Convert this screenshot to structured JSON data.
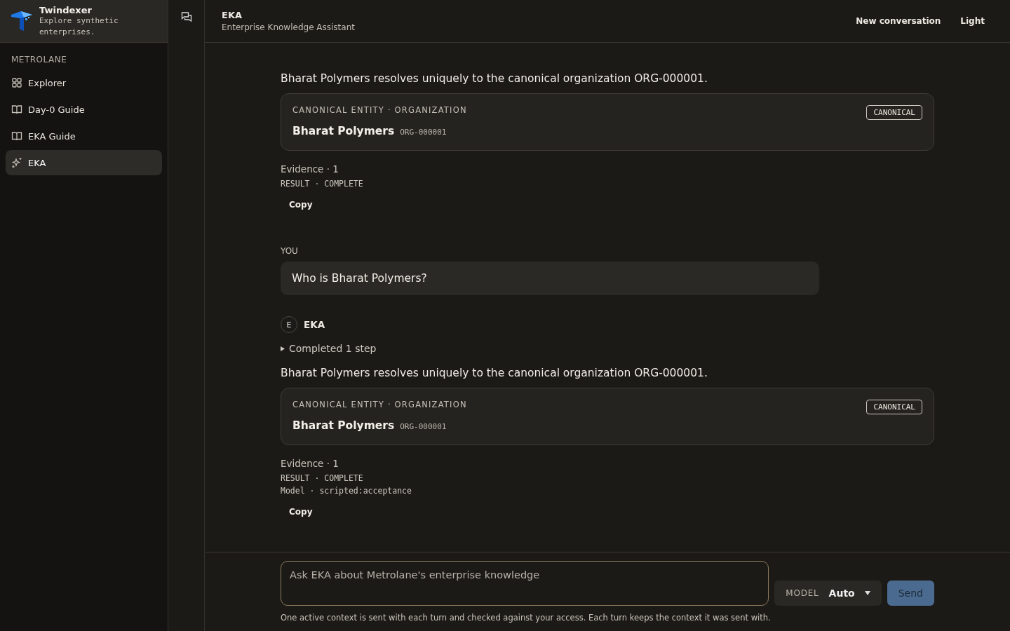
{
  "brand": {
    "name": "Twindexer",
    "tagline": "Explore synthetic enterprises."
  },
  "sidebar": {
    "section": "METROLANE",
    "items": [
      {
        "label": "Explorer",
        "kind": "grid",
        "selected": false
      },
      {
        "label": "Day-0 Guide",
        "kind": "book",
        "selected": false
      },
      {
        "label": "EKA Guide",
        "kind": "book",
        "selected": false
      },
      {
        "label": "EKA",
        "kind": "sparkle",
        "selected": true
      }
    ]
  },
  "header": {
    "title": "EKA",
    "subtitle": "Enterprise Knowledge Assistant",
    "actions": [
      "New conversation",
      "Light"
    ]
  },
  "messages": [
    {
      "kind": "assistant",
      "text": "Bharat Polymers resolves uniquely to the canonical organization ORG-000001.",
      "entity": {
        "label": "CANONICAL ENTITY · ORGANIZATION",
        "badge": "CANONICAL",
        "name": "Bharat Polymers",
        "id": "ORG-000001"
      },
      "evidence": "Evidence · 1",
      "meta": [
        "RESULT · COMPLETE"
      ],
      "copy": "Copy"
    },
    {
      "kind": "user",
      "role": "YOU",
      "text": "Who is Bharat Polymers?"
    },
    {
      "kind": "assistant",
      "author": {
        "initial": "E",
        "name": "EKA"
      },
      "steps": {
        "label": "Completed 1 step",
        "expanded": false
      },
      "text": "Bharat Polymers resolves uniquely to the canonical organization ORG-000001.",
      "entity": {
        "label": "CANONICAL ENTITY · ORGANIZATION",
        "badge": "CANONICAL",
        "name": "Bharat Polymers",
        "id": "ORG-000001"
      },
      "evidence": "Evidence · 1",
      "meta": [
        "RESULT · COMPLETE",
        "Model · scripted:acceptance"
      ],
      "copy": "Copy"
    }
  ],
  "composer": {
    "placeholder": "Ask EKA about Metrolane's enterprise knowledge",
    "model_label": "MODEL",
    "model_value": "Auto",
    "send": "Send",
    "note": "One active context is sent with each turn and checked against your access. Each turn keeps the context it was sent with."
  }
}
